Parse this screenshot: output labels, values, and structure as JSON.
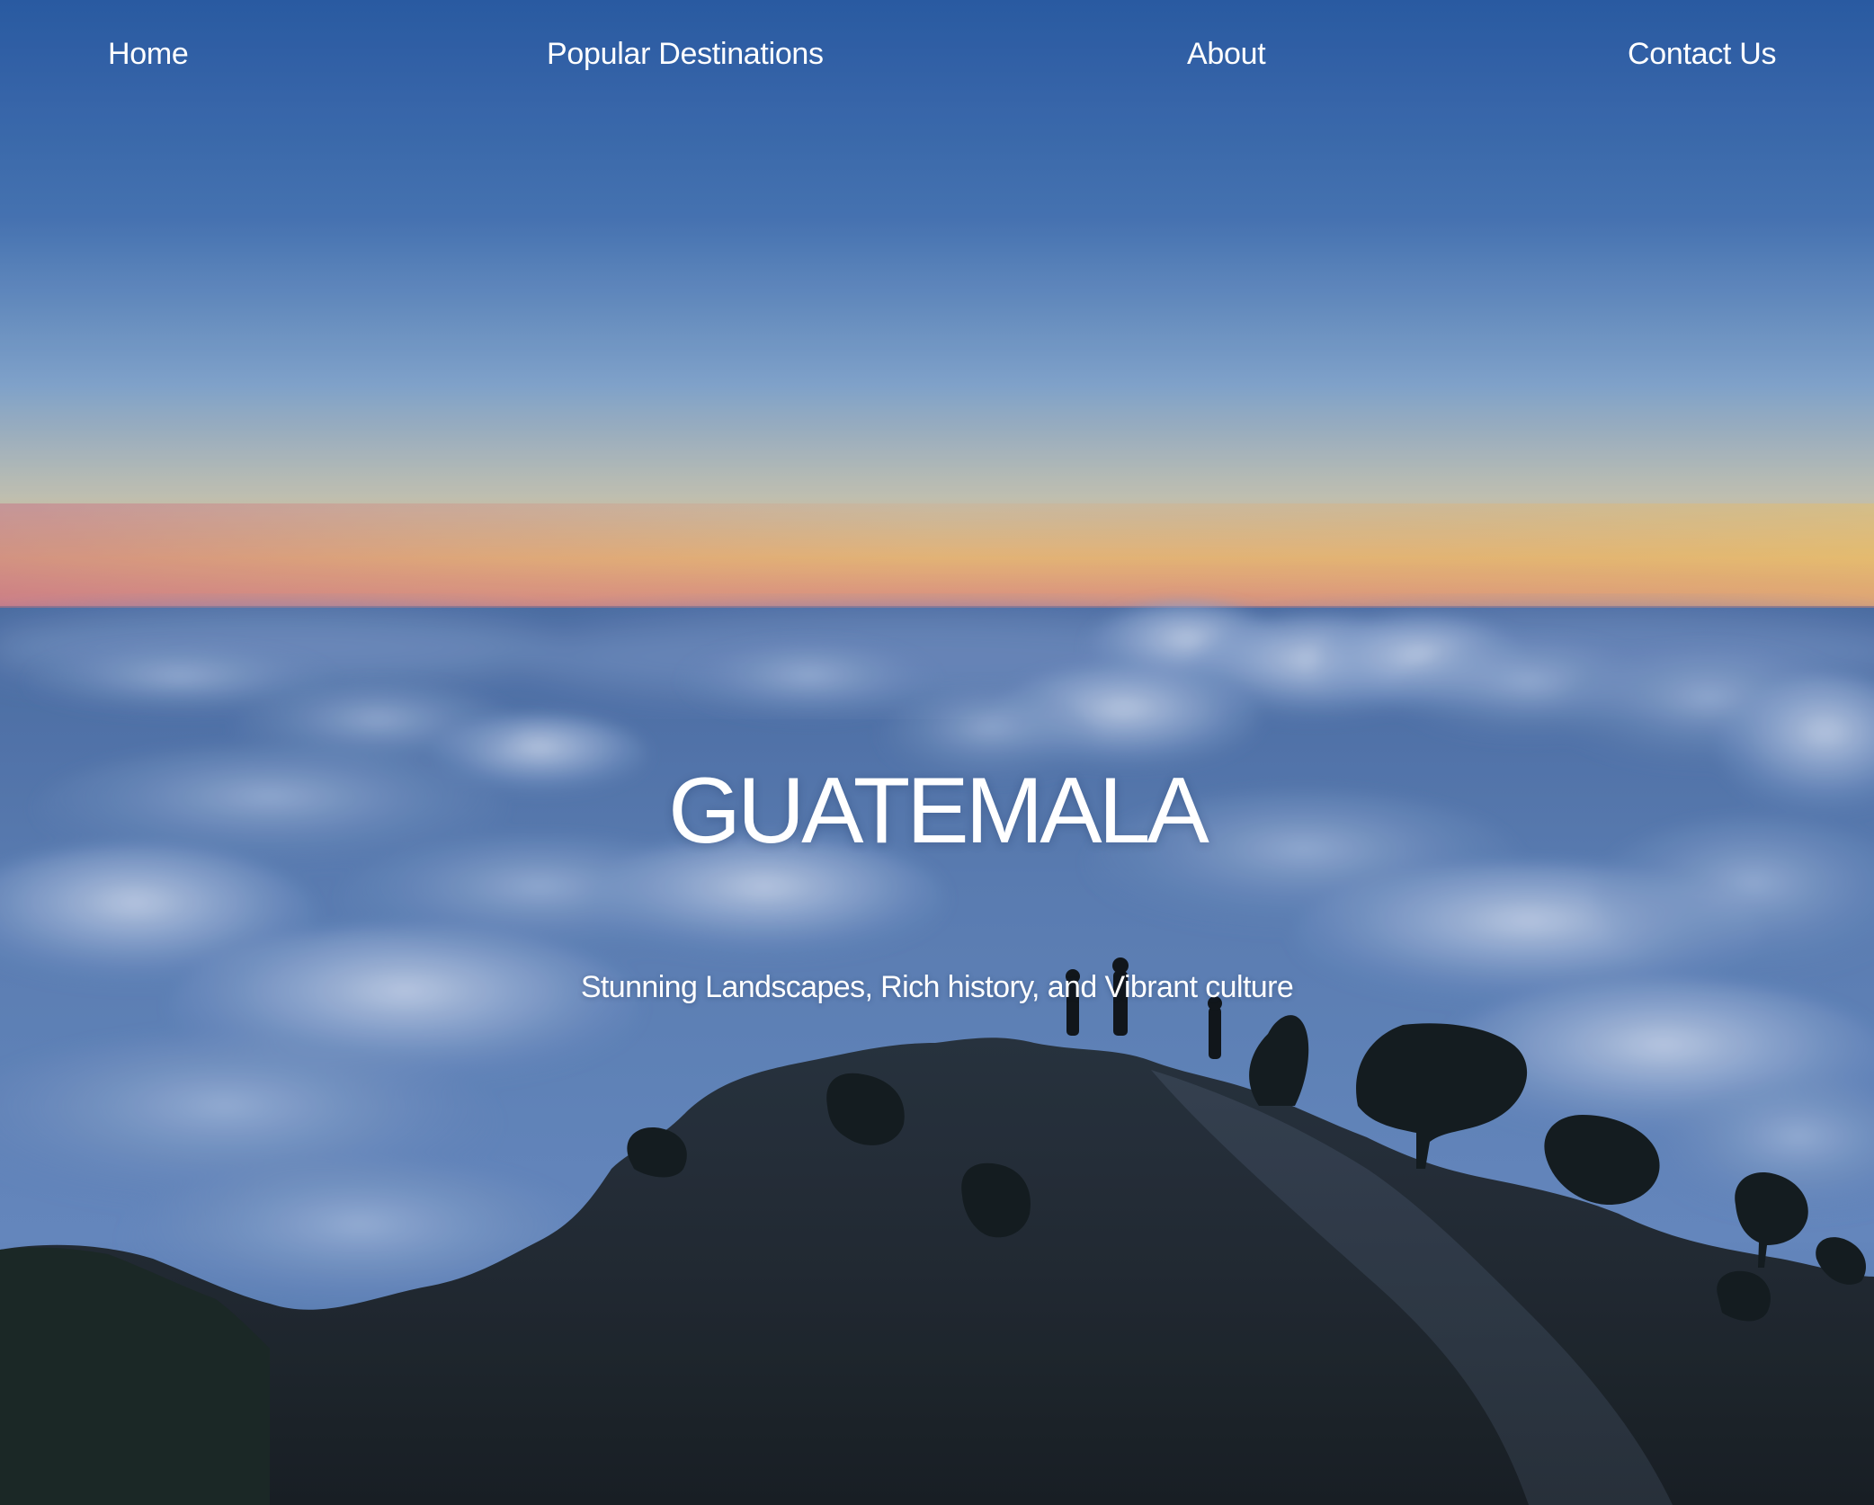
{
  "nav": {
    "home": "Home",
    "destinations": "Popular Destinations",
    "about": "About",
    "contact": "Contact Us"
  },
  "hero": {
    "title": "GUATEMALA",
    "subtitle": "Stunning Landscapes, Rich history, and Vibrant culture"
  },
  "icons": [
    "hero-background-photo"
  ],
  "colors": {
    "sky_top": "#2d5fa6",
    "sky_mid": "#8aaed6",
    "horizon_glow": "#f0c27a",
    "horizon_pink": "#d9808a",
    "clouds": "#5f82b8",
    "text": "#ffffff"
  }
}
